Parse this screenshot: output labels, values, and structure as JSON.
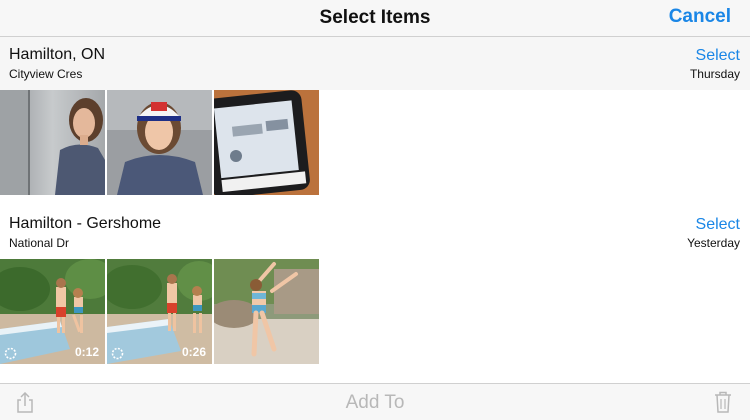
{
  "nav": {
    "title": "Select Items",
    "cancel_label": "Cancel"
  },
  "sections": [
    {
      "title": "Hamilton, ON",
      "subtitle": "Cityview Cres",
      "select_label": "Select",
      "date": "Thursday",
      "photos": [
        {
          "kind": "photo",
          "subject": "person-at-elevator"
        },
        {
          "kind": "photo",
          "subject": "person-with-cap"
        },
        {
          "kind": "photo",
          "subject": "phone-on-keyboard"
        }
      ]
    },
    {
      "title": "Hamilton - Gershome",
      "subtitle": "National Dr",
      "select_label": "Select",
      "date": "Yesterday",
      "photos": [
        {
          "kind": "video",
          "duration": "0:12",
          "subject": "kids-by-pool"
        },
        {
          "kind": "video",
          "duration": "0:26",
          "subject": "kids-by-pool"
        },
        {
          "kind": "photo",
          "subject": "girl-dancing"
        }
      ]
    }
  ],
  "toolbar": {
    "add_label": "Add To",
    "share_icon": "share-icon",
    "trash_icon": "trash-icon"
  },
  "colors": {
    "accent": "#1a86e6",
    "disabled": "#b8b8b8",
    "bar": "#f7f7f7"
  }
}
